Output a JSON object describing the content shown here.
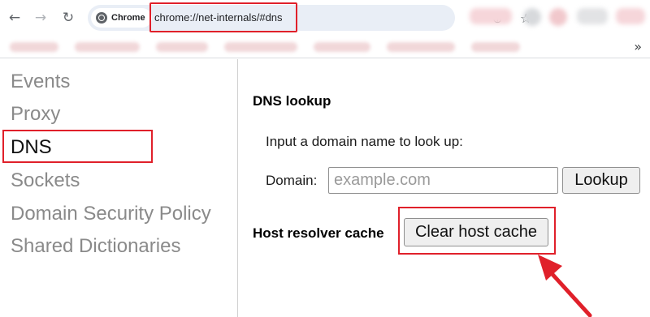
{
  "browser": {
    "site_chip_label": "Chrome",
    "url": "chrome://net-internals/#dns",
    "icons": {
      "back": "arrow-left-icon",
      "forward": "arrow-right-icon",
      "reload": "reload-icon",
      "zoom": "zoom-icon",
      "bookmark": "star-icon",
      "more": "chevron-double-right-icon"
    }
  },
  "sidebar": {
    "items": [
      {
        "label": "Events",
        "selected": false
      },
      {
        "label": "Proxy",
        "selected": false
      },
      {
        "label": "DNS",
        "selected": true
      },
      {
        "label": "Sockets",
        "selected": false
      },
      {
        "label": "Domain Security Policy",
        "selected": false
      },
      {
        "label": "Shared Dictionaries",
        "selected": false
      }
    ]
  },
  "main": {
    "dns_lookup_title": "DNS lookup",
    "lookup_prompt": "Input a domain name to look up:",
    "domain_label": "Domain:",
    "domain_placeholder": "example.com",
    "domain_value": "",
    "lookup_button": "Lookup",
    "host_cache_title": "Host resolver cache",
    "clear_cache_button": "Clear host cache"
  },
  "colors": {
    "highlight": "#e0202a",
    "sidebar_inactive": "#8a8a8a",
    "sidebar_active": "#111111"
  }
}
